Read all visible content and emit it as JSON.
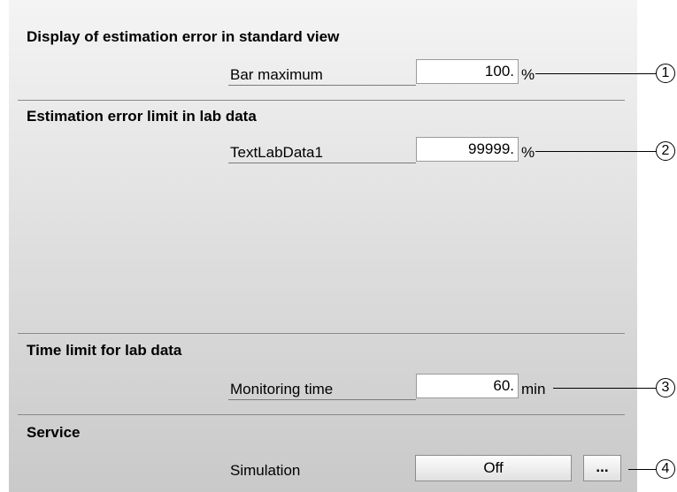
{
  "sections": [
    {
      "title": "Display of estimation error in standard view",
      "row": {
        "label": "Bar maximum",
        "value": "100.",
        "unit": "%",
        "callout": "1"
      }
    },
    {
      "title": "Estimation error limit in lab data",
      "row": {
        "label": "TextLabData1",
        "value": "99999.",
        "unit": "%",
        "callout": "2"
      }
    },
    {
      "title": "Time limit for lab data",
      "row": {
        "label": "Monitoring time",
        "value": "60.",
        "unit": "min",
        "callout": "3"
      }
    },
    {
      "title": "Service",
      "row": {
        "label": "Simulation",
        "value": "Off",
        "more_button": "...",
        "callout": "4"
      }
    }
  ],
  "colors": {
    "panel_gradient_top": "#f4f4f4",
    "panel_gradient_bottom": "#c9c9c9",
    "field_background": "#ffffff",
    "divider": "#8a8a8a"
  }
}
